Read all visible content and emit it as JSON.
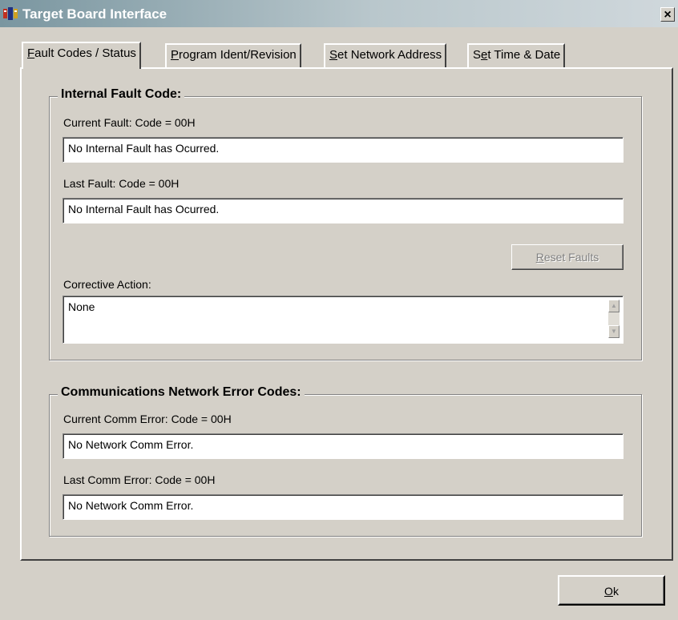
{
  "window": {
    "title": "Target Board Interface",
    "close_glyph": "×"
  },
  "tabs": [
    {
      "label": "Fault Codes / Status",
      "mn": "F",
      "rest": "ault Codes / Status"
    },
    {
      "label": "Program Ident/Revision",
      "mn": "P",
      "rest": "rogram Ident/Revision"
    },
    {
      "label": "Set Network Address",
      "mn": "S",
      "rest": "et Network Address"
    },
    {
      "label": "Set Time & Date",
      "pre": "S",
      "mn": "e",
      "rest": "t Time & Date"
    }
  ],
  "internal_fault": {
    "group_title": "Internal Fault Code:",
    "current_label": "Current Fault: Code = 00H",
    "current_value": "No Internal Fault has Ocurred.",
    "last_label": "Last Fault: Code = 00H",
    "last_value": "No Internal Fault has Ocurred.",
    "reset_button": {
      "mn": "R",
      "rest": "eset Faults"
    },
    "corrective_label": "Corrective Action:",
    "corrective_value": "None"
  },
  "comm_errors": {
    "group_title": "Communications Network Error Codes:",
    "current_label": "Current Comm Error: Code = 00H",
    "current_value": "No Network Comm Error.",
    "last_label": "Last Comm Error: Code = 00H",
    "last_value": "No Network Comm Error."
  },
  "ok_button": {
    "mn": "O",
    "rest": "k"
  },
  "icons": {
    "app": "app-icon",
    "close": "close-icon",
    "scroll_up": "scroll-up-icon",
    "scroll_down": "scroll-down-icon"
  }
}
